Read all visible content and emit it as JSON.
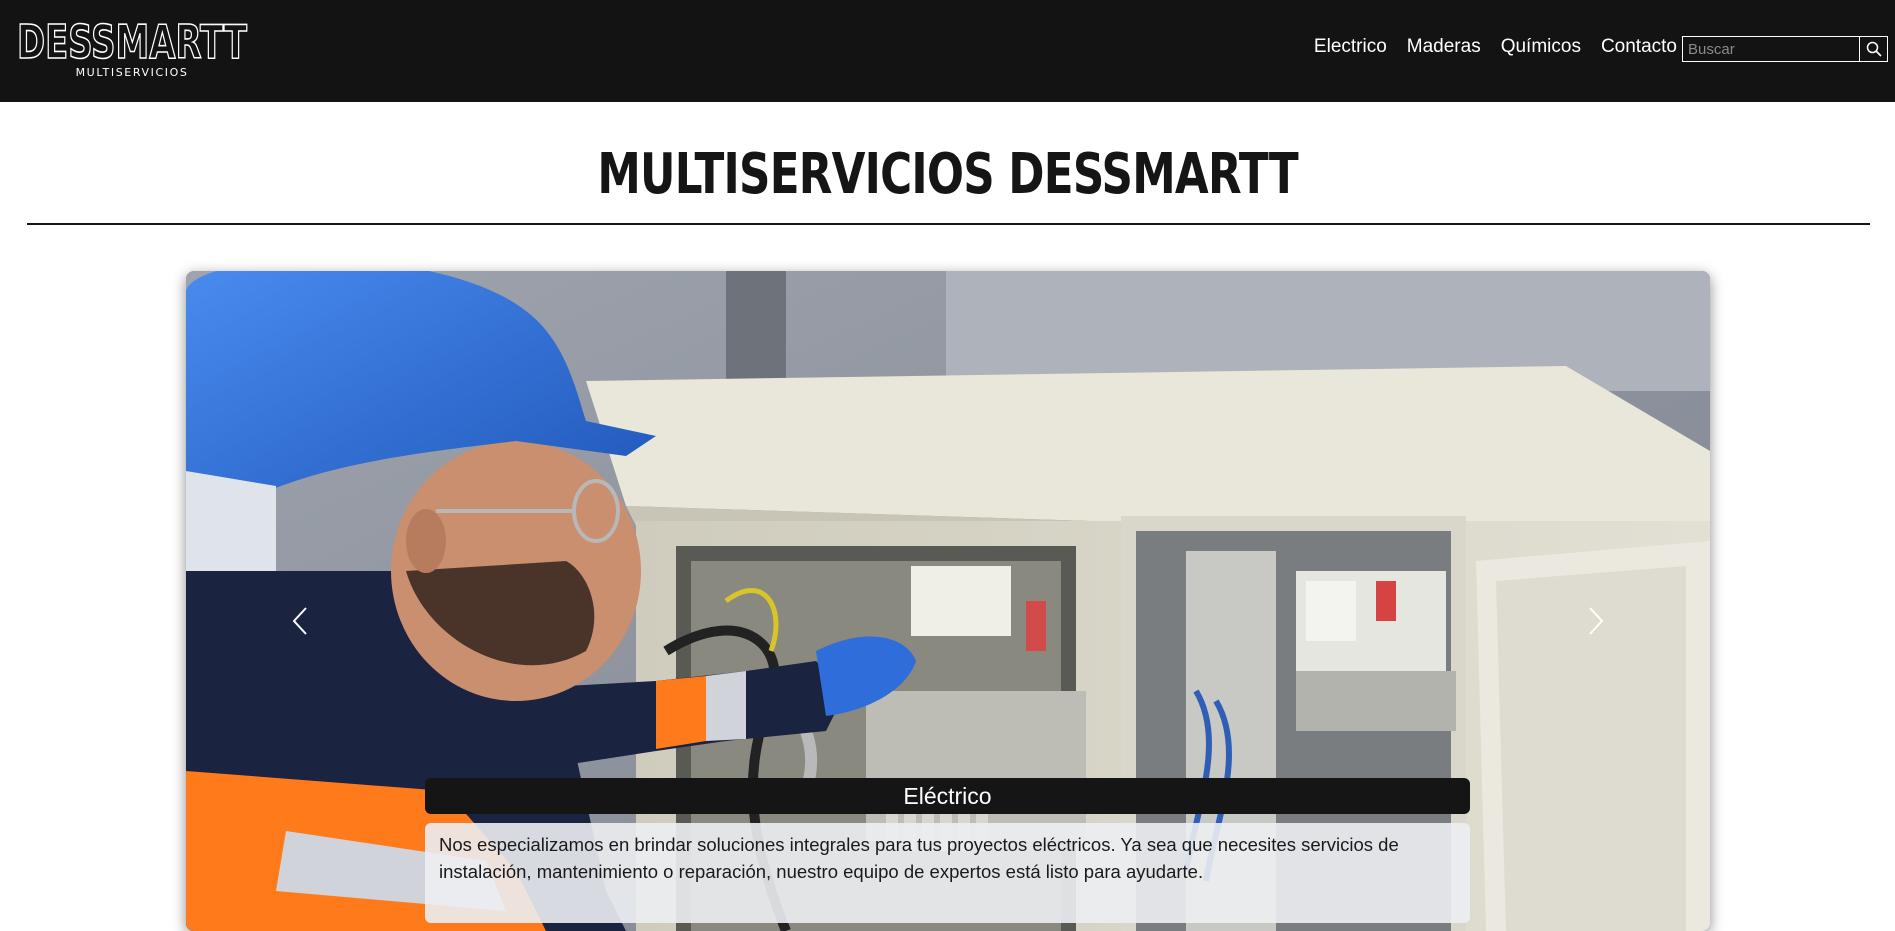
{
  "header": {
    "logo_text": "DESSMARTT",
    "logo_subtitle": "MULTISERVICIOS",
    "nav": [
      {
        "label": "Electrico"
      },
      {
        "label": "Maderas"
      },
      {
        "label": "Químicos"
      },
      {
        "label": "Contacto"
      }
    ],
    "search": {
      "placeholder": "Buscar",
      "value": ""
    }
  },
  "main": {
    "title": "MULTISERVICIOS DESSMARTT",
    "carousel": {
      "slide": {
        "image_description": "Worker with blue hard hat working on electrical panel",
        "caption_title": "Eléctrico",
        "caption_text": "Nos especializamos en brindar soluciones integrales para tus proyectos eléctricos. Ya sea que necesites servicios de instalación, mantenimiento o reparación, nuestro equipo de expertos está listo para ayudarte."
      },
      "prev_icon": "chevron-left-icon",
      "next_icon": "chevron-right-icon"
    }
  },
  "colors": {
    "header_bg": "#131313",
    "title": "#151515",
    "caption_title_bg": "#151515",
    "caption_text_bg": "#eceef2",
    "helmet": "#2f6fd6",
    "vest_orange": "#ff7a1a"
  }
}
